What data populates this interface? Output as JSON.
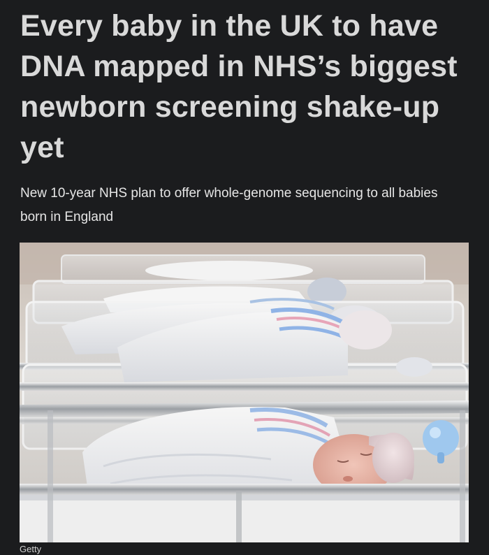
{
  "article": {
    "headline": "Every baby in the UK to have DNA mapped in NHS’s biggest newborn screening shake-up yet",
    "standfirst": "New 10-year NHS plan to offer whole-genome sequencing to all babies born in England",
    "image": {
      "credit": "Getty"
    }
  }
}
